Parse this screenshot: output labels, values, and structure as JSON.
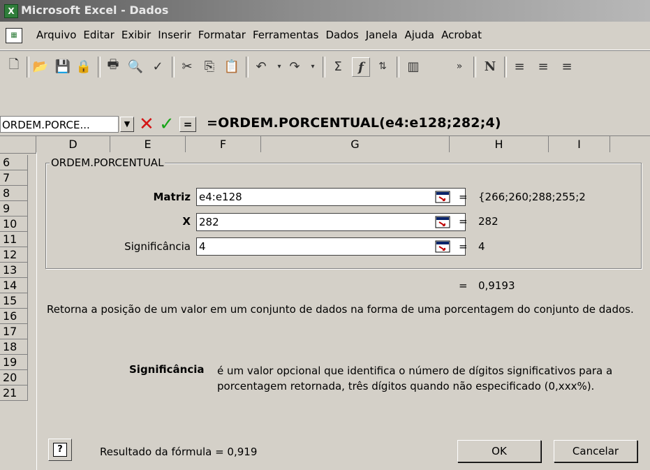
{
  "window": {
    "title": "Microsoft Excel - Dados",
    "app_icon": "excel-icon"
  },
  "menu": {
    "items": [
      {
        "label": "Arquivo"
      },
      {
        "label": "Editar"
      },
      {
        "label": "Exibir"
      },
      {
        "label": "Inserir"
      },
      {
        "label": "Formatar"
      },
      {
        "label": "Ferramentas"
      },
      {
        "label": "Dados"
      },
      {
        "label": "Janela"
      },
      {
        "label": "Ajuda"
      },
      {
        "label": "Acrobat"
      }
    ]
  },
  "toolbar": {
    "icons": [
      "new-icon",
      "open-icon",
      "save-icon",
      "permission-icon",
      "print-icon",
      "print-preview-icon",
      "spelling-icon",
      "cut-icon",
      "copy-icon",
      "paste-icon",
      "undo-icon",
      "redo-icon",
      "autosum-icon",
      "function-icon",
      "sort-ascending-icon",
      "chart-wizard-icon",
      "more-buttons-icon",
      "bold-icon",
      "align-left-icon",
      "align-center-icon",
      "align-right-icon"
    ]
  },
  "formula_bar": {
    "name_box": "ORDEM.PORCE...",
    "cancel_symbol": "✕",
    "enter_symbol": "✓",
    "equals_symbol": "=",
    "formula": "=ORDEM.PORCENTUAL(e4:e128;282;4)"
  },
  "columns": [
    "D",
    "E",
    "F",
    "G",
    "H",
    "I"
  ],
  "rows": [
    "6",
    "7",
    "8",
    "9",
    "10",
    "11",
    "12",
    "13",
    "14",
    "15",
    "16",
    "17",
    "18",
    "19",
    "20",
    "21"
  ],
  "dialog": {
    "function_name": "ORDEM.PORCENTUAL",
    "args": [
      {
        "label": "Matriz",
        "value": "e4:e128",
        "result": "{266;260;288;255;2",
        "bold": true
      },
      {
        "label": "X",
        "value": "282",
        "result": "282",
        "bold": true
      },
      {
        "label": "Significância",
        "value": "4",
        "result": "4",
        "bold": false
      }
    ],
    "equals": "=",
    "function_result": "0,9193",
    "description": "Retorna a posição de um valor em um conjunto de dados na forma de uma porcentagem do conjunto de dados.",
    "arg_help_label": "Significância",
    "arg_help_text": "é um valor opcional que identifica o número de dígitos significativos para a porcentagem retornada, três dígitos quando não especificado (0,xxx%).",
    "help_symbol": "?",
    "formula_result": "Resultado da fórmula = 0,919",
    "ok_label": "OK",
    "cancel_label": "Cancelar"
  }
}
